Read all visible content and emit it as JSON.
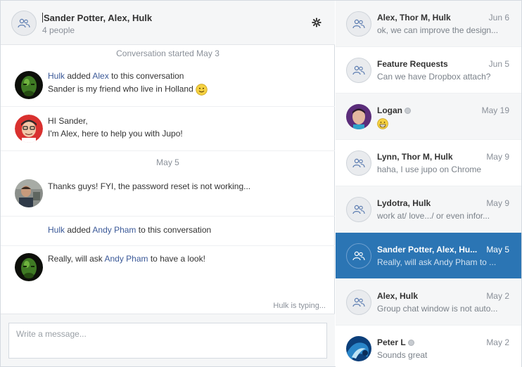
{
  "chat": {
    "title": "Sander Potter, Alex, Hulk",
    "subtitle": "4 people",
    "settings_icon": "gear-icon",
    "group_icon": "people-icon"
  },
  "messages": {
    "divider1": "Conversation started May 3",
    "divider2": "May 5",
    "m1": {
      "actor": "Hulk",
      "added_text": " added ",
      "added_person": "Alex",
      "added_suffix": " to this conversation",
      "text": "Sander is my friend who live in Holland",
      "emoji": "smile-emoji"
    },
    "m2": {
      "line1": "HI Sander,",
      "line2": "I'm Alex, here to help you with Jupo!"
    },
    "m3": {
      "text": "Thanks guys! FYI, the password reset is not working..."
    },
    "m4": {
      "actor": "Hulk",
      "added_text": " added ",
      "added_person": "Andy Pham",
      "added_suffix": " to this conversation"
    },
    "m5": {
      "prefix": "Really, will ask ",
      "mention": "Andy Pham",
      "suffix": " to have a look!"
    },
    "typing": "Hulk is typing..."
  },
  "composer": {
    "placeholder": "Write a message..."
  },
  "conversations": [
    {
      "name": "Alex, Thor M, Hulk",
      "date": "Jun 6",
      "preview": "ok, we can improve the design..."
    },
    {
      "name": "Feature Requests",
      "date": "Jun 5",
      "preview": "Can we have Dropbox attach?"
    },
    {
      "name": "Logan",
      "date": "May 19",
      "preview": "",
      "preview_icon": "grin-emoji"
    },
    {
      "name": "Lynn, Thor M, Hulk",
      "date": "May 9",
      "preview": "haha, I use jupo on Chrome"
    },
    {
      "name": "Lydotra, Hulk",
      "date": "May 9",
      "preview": "work at/ love.../ or even infor..."
    },
    {
      "name": "Sander Potter, Alex, Hu...",
      "date": "May 5",
      "preview": "Really, will ask Andy Pham to ..."
    },
    {
      "name": "Alex, Hulk",
      "date": "May 2",
      "preview": "Group chat window is not auto..."
    },
    {
      "name": "Peter L",
      "date": "May 2",
      "preview": "Sounds great"
    }
  ],
  "colors": {
    "accent": "#2b75b4",
    "link": "#3b5998",
    "muted": "#8a9099"
  }
}
